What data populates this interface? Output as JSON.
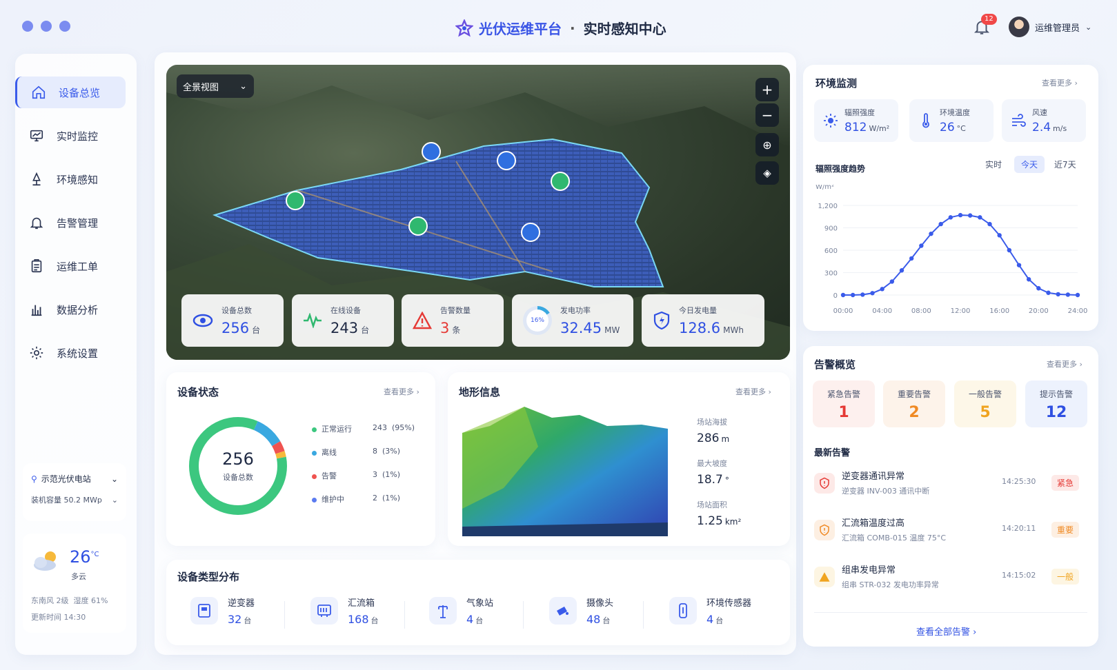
{
  "header": {
    "title": "光伏运维平台",
    "separator": "·",
    "subtitle": "实时感知中心",
    "notif_count": "12",
    "user_name": "运维管理员"
  },
  "sidebar": {
    "items": [
      {
        "label": "设备总览",
        "icon": "home-icon"
      },
      {
        "label": "实时监控",
        "icon": "monitor-chart-icon"
      },
      {
        "label": "环境感知",
        "icon": "tree-icon"
      },
      {
        "label": "告警管理",
        "icon": "bell-icon"
      },
      {
        "label": "运维工单",
        "icon": "clipboard-icon"
      },
      {
        "label": "数据分析",
        "icon": "bar-chart-icon"
      },
      {
        "label": "系统设置",
        "icon": "gear-icon"
      }
    ],
    "station": {
      "name": "示范光伏电站",
      "capacity": "装机容量 50.2 MWp"
    },
    "weather": {
      "temp": "26",
      "unit": "°C",
      "desc": "多云",
      "wind": "东南风 2级",
      "humidity": "湿度 61%",
      "updated": "更新时间 14:30"
    }
  },
  "map": {
    "view_select": "全景视图",
    "stats": [
      {
        "label": "设备总数",
        "value": "256",
        "unit": "台",
        "color": "#2f50e2"
      },
      {
        "label": "在线设备",
        "value": "243",
        "unit": "台",
        "color": "#1f2a44"
      },
      {
        "label": "告警数量",
        "value": "3",
        "unit": "条",
        "color": "#e53935"
      },
      {
        "label": "发电功率",
        "value": "32.45",
        "unit": "MW",
        "color": "#2f50e2",
        "ring": "16%"
      },
      {
        "label": "今日发电量",
        "value": "128.6",
        "unit": "MWh",
        "color": "#2f50e2"
      }
    ]
  },
  "device_status": {
    "title": "设备状态",
    "more": "查看更多 ›",
    "total": "256",
    "total_label": "设备总数",
    "legend": [
      {
        "label": "正常运行",
        "count": "243",
        "pct": "(95%)",
        "color": "#3cc77f"
      },
      {
        "label": "离线",
        "count": "8",
        "pct": "(3%)",
        "color": "#3aa8e0"
      },
      {
        "label": "告警",
        "count": "3",
        "pct": "(1%)",
        "color": "#ef5350"
      },
      {
        "label": "维护中",
        "count": "2",
        "pct": "(1%)",
        "color": "#5b7bf0"
      }
    ]
  },
  "terrain": {
    "title": "地形信息",
    "more": "查看更多 ›",
    "stats": [
      {
        "label": "场站海拔",
        "value": "286",
        "unit": "m"
      },
      {
        "label": "最大坡度",
        "value": "18.7",
        "unit": "°"
      },
      {
        "label": "场站面积",
        "value": "1.25",
        "unit": "km²"
      }
    ]
  },
  "device_types": {
    "title": "设备类型分布",
    "items": [
      {
        "label": "逆变器",
        "value": "32",
        "unit": "台",
        "icon": "inverter-icon"
      },
      {
        "label": "汇流箱",
        "value": "168",
        "unit": "台",
        "icon": "combiner-box-icon"
      },
      {
        "label": "气象站",
        "value": "4",
        "unit": "台",
        "icon": "weather-station-icon"
      },
      {
        "label": "摄像头",
        "value": "48",
        "unit": "台",
        "icon": "camera-icon"
      },
      {
        "label": "环境传感器",
        "value": "4",
        "unit": "台",
        "icon": "sensor-icon"
      }
    ]
  },
  "environment": {
    "title": "环境监测",
    "more": "查看更多 ›",
    "metrics": [
      {
        "label": "辐照强度",
        "value": "812",
        "unit": "W/m²",
        "icon": "sun-icon"
      },
      {
        "label": "环境温度",
        "value": "26",
        "unit": "°C",
        "icon": "thermometer-icon"
      },
      {
        "label": "风速",
        "value": "2.4",
        "unit": "m/s",
        "icon": "wind-icon"
      }
    ],
    "trend_title": "辐照强度趋势",
    "tabs": [
      "实时",
      "今天",
      "近7天"
    ],
    "active_tab": "今天"
  },
  "chart_data": {
    "type": "line",
    "title": "辐照强度趋势",
    "ylabel": "W/m²",
    "xlabel": "",
    "x_ticks": [
      "00:00",
      "04:00",
      "08:00",
      "12:00",
      "16:00",
      "20:00",
      "24:00"
    ],
    "y_ticks": [
      "0",
      "300",
      "600",
      "900",
      "1,200"
    ],
    "ylim": [
      0,
      1200
    ],
    "xlim": [
      0,
      24
    ],
    "series": [
      {
        "x": [
          0,
          1,
          2,
          3,
          4,
          5,
          6,
          7,
          8,
          9,
          10,
          11,
          12,
          13,
          14,
          15,
          16,
          17,
          18,
          19,
          20,
          21,
          22,
          23,
          24
        ],
        "y": [
          0,
          0,
          5,
          25,
          80,
          180,
          330,
          490,
          660,
          820,
          950,
          1040,
          1070,
          1065,
          1040,
          950,
          800,
          600,
          400,
          210,
          90,
          30,
          10,
          5,
          0
        ]
      }
    ],
    "color": "#3a5bea",
    "grid": true
  },
  "alarms": {
    "title": "告警概览",
    "more": "查看更多 ›",
    "summary": [
      {
        "label": "紧急告警",
        "value": "1",
        "color": "#e53935",
        "bg": "#fdf0ee"
      },
      {
        "label": "重要告警",
        "value": "2",
        "color": "#f08a24",
        "bg": "#fdf3ea"
      },
      {
        "label": "一般告警",
        "value": "5",
        "color": "#f0a420",
        "bg": "#fdf7e8"
      },
      {
        "label": "提示告警",
        "value": "12",
        "color": "#2f50e2",
        "bg": "#edf2fd"
      }
    ],
    "recent_title": "最新告警",
    "recent": [
      {
        "title": "逆变器通讯异常",
        "desc": "逆变器 INV-003 通讯中断",
        "time": "14:25:30",
        "level": "紧急",
        "color": "#e53935",
        "bg": "#fde9e7"
      },
      {
        "title": "汇流箱温度过高",
        "desc": "汇流箱 COMB-015 温度 75°C",
        "time": "14:20:11",
        "level": "重要",
        "color": "#f08a24",
        "bg": "#fdefe2"
      },
      {
        "title": "组串发电异常",
        "desc": "组串 STR-032 发电功率异常",
        "time": "14:15:02",
        "level": "一般",
        "color": "#f0a420",
        "bg": "#fdf5e2"
      }
    ],
    "view_all": "查看全部告警 ›"
  }
}
